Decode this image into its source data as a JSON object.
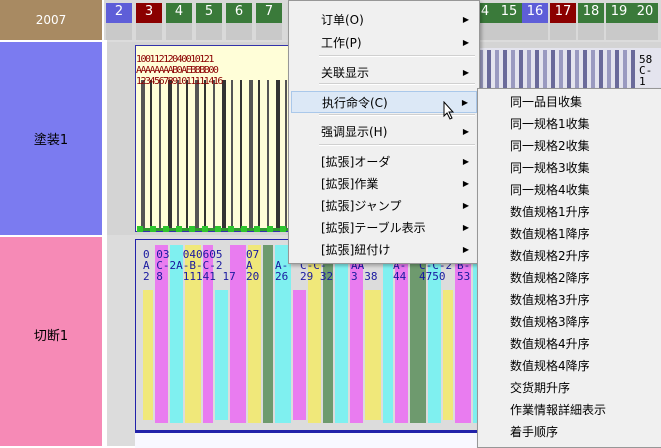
{
  "year_label": "2007",
  "rows": [
    {
      "label": "塗装1"
    },
    {
      "label": "切断1"
    }
  ],
  "days": [
    {
      "num": "2",
      "color": "#5e5ed8"
    },
    {
      "num": "3",
      "color": "#8b0000"
    },
    {
      "num": "4",
      "color": "#3a7a3a"
    },
    {
      "num": "5",
      "color": "#3a7a3a"
    },
    {
      "num": "6",
      "color": "#3a7a3a"
    },
    {
      "num": "7",
      "color": "#3a7a3a"
    },
    {
      "num": "4",
      "color": "#3a7a3a"
    },
    {
      "num": "15",
      "color": "#3a7a3a"
    },
    {
      "num": "16",
      "color": "#5e5ed8"
    },
    {
      "num": "17",
      "color": "#8b0000"
    },
    {
      "num": "18",
      "color": "#3a7a3a"
    },
    {
      "num": "19",
      "color": "#3a7a3a"
    },
    {
      "num": "20",
      "color": "#3a7a3a"
    }
  ],
  "context_menu": {
    "items": [
      {
        "label": "订单(O)",
        "submenu": true
      },
      {
        "label": "工作(P)",
        "submenu": true
      },
      {
        "label": "关联显示",
        "submenu": true
      },
      {
        "label": "执行命令(C)",
        "submenu": true,
        "highlighted": true
      },
      {
        "label": "强调显示(H)",
        "submenu": true
      },
      {
        "label": "[拡張]オーダ",
        "submenu": true
      },
      {
        "label": "[拡張]作業",
        "submenu": true
      },
      {
        "label": "[拡張]ジャンプ",
        "submenu": true
      },
      {
        "label": "[拡張]テーブル表示",
        "submenu": true
      },
      {
        "label": "[拡張]紐付け",
        "submenu": true
      }
    ]
  },
  "submenu": {
    "items": [
      {
        "label": "同一品目收集"
      },
      {
        "label": "同一规格1收集"
      },
      {
        "label": "同一规格2收集"
      },
      {
        "label": "同一规格3收集"
      },
      {
        "label": "同一规格4收集"
      },
      {
        "label": "数值规格1升序"
      },
      {
        "label": "数值规格1降序"
      },
      {
        "label": "数值规格2升序"
      },
      {
        "label": "数值规格2降序"
      },
      {
        "label": "数值规格3升序"
      },
      {
        "label": "数值规格3降序"
      },
      {
        "label": "数值规格4升序"
      },
      {
        "label": "数值规格4降序"
      },
      {
        "label": "交货期升序"
      },
      {
        "label": "作業情報詳細表示"
      },
      {
        "label": "着手顺序"
      }
    ]
  },
  "gantt_text": {
    "row1_col1": "10011212040010121\nAAAAAAAAB0AEBBBB00\n1234567891011111416",
    "row1_right": "58\nC-\n1",
    "row2_a": "0 03  040605\nA C-2A-B-C-2\n2 8   11141 17",
    "row2_b": "07\nA\n20",
    "row2_c": "A-\n26",
    "row2_d": "C-C-\n29 32",
    "row2_e": "AA\n3 38",
    "row2_f": "A-\n44",
    "row2_g": "C-C-2\n4750",
    "row2_h": "B-\n53"
  }
}
